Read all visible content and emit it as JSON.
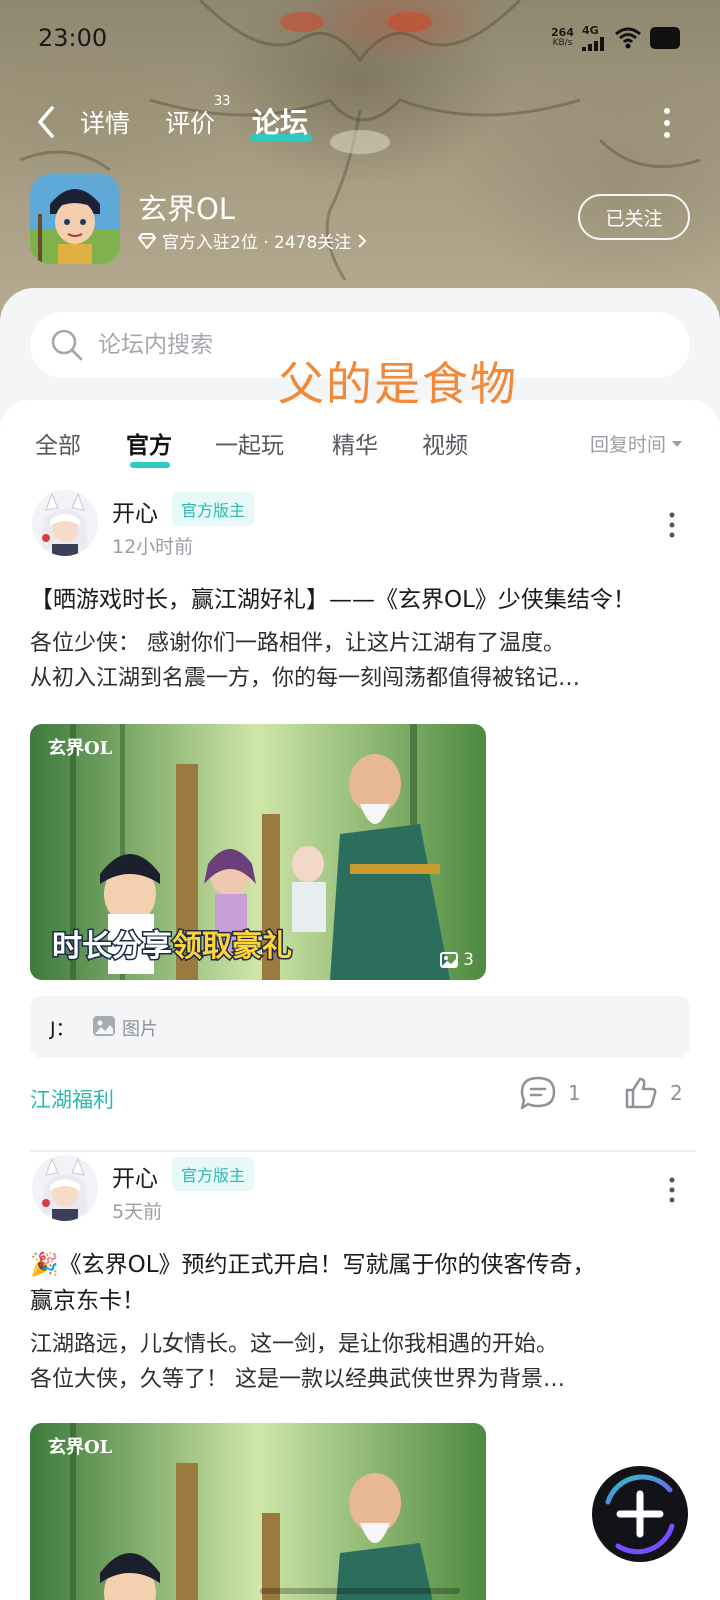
{
  "status_bar": {
    "time": "23:00",
    "net_speed_value": "264",
    "net_speed_unit": "KB/s",
    "net_type": "4G"
  },
  "nav": {
    "tabs": [
      {
        "label": "详情"
      },
      {
        "label": "评价"
      },
      {
        "label": "论坛"
      }
    ],
    "review_badge": "33"
  },
  "game": {
    "name": "玄界OL",
    "meta": "官方入驻2位 · 2478关注",
    "follow_label": "已关注"
  },
  "search": {
    "placeholder": "论坛内搜索"
  },
  "categories": {
    "tabs": [
      "全部",
      "官方",
      "一起玩",
      "精华",
      "视频"
    ],
    "selected": "官方",
    "sort_label": "回复时间"
  },
  "posts": [
    {
      "author": "开心",
      "role": "官方版主",
      "time": "12小时前",
      "title": "【晒游戏时长，赢江湖好礼】——《玄界OL》少侠集结令！",
      "body_lines": [
        "各位少侠： 感谢你们一路相伴，让这片江湖有了温度。",
        "从初入江湖到名震一方，你的每一刻闯荡都值得被铭记…"
      ],
      "image_logo": "玄界OL",
      "image_caption_a": "时长分享",
      "image_caption_b": "领取豪礼",
      "image_count": "3",
      "reply_user": "J：",
      "reply_content": "图片",
      "tag": "江湖福利",
      "comments": "1",
      "likes": "2"
    },
    {
      "author": "开心",
      "role": "官方版主",
      "time": "5天前",
      "title_line1": "🎉《玄界OL》预约正式开启！写就属于你的侠客传奇，",
      "title_line2": "赢京东卡！",
      "body_lines": [
        "江湖路远，儿女情长。这一剑，是让你我相遇的开始。",
        "各位大侠，久等了！ 这是一款以经典武侠世界为背景…"
      ],
      "image_logo": "玄界OL"
    }
  ],
  "image_overlay_text": "父的是食物",
  "colors": {
    "accent": "#2ec9c0",
    "tag_text": "#2bb8b0",
    "overlay_text": "#f08a3a"
  }
}
